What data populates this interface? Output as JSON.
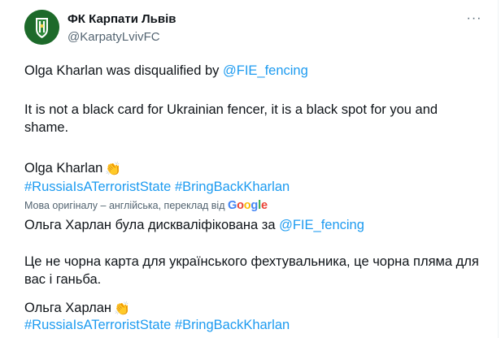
{
  "account": {
    "name": "ФК Карпати Львів",
    "handle": "@KarpatyLvivFC"
  },
  "menu": {
    "more_glyph": "···"
  },
  "original": {
    "line1_text": "Olga Kharlan was disqualified by ",
    "line1_mention": "@FIE_fencing",
    "line2": "It is not a black card for Ukrainian fencer, it is a black spot for you and",
    "line3": "shame.",
    "line4_text": "Olga Kharlan",
    "line4_emoji": "👏",
    "hashtag1": "#RussiaIsATerroristState",
    "hashtag2": "#BringBackKharlan"
  },
  "translation_meta": {
    "text": "Мова оригіналу – англійська, переклад від ",
    "g1": "G",
    "g2": "o",
    "g3": "o",
    "g4": "g",
    "g5": "l",
    "g6": "e"
  },
  "translated": {
    "line1_text": "Ольга Харлан була дискваліфікована за ",
    "line1_mention": "@FIE_fencing",
    "line2": "Це не чорна карта для українського фехтувальника, це чорна пляма для",
    "line3": "вас і ганьба.",
    "line4_text": "Ольга Харлан",
    "line4_emoji": "👏",
    "hashtag1": "#RussiaIsATerroristState",
    "hashtag2": "#BringBackKharlan"
  },
  "colors": {
    "link": "#1d9bf0",
    "text": "#0f1419",
    "secondary": "#536471",
    "avatar_green": "#1d6a2a"
  }
}
